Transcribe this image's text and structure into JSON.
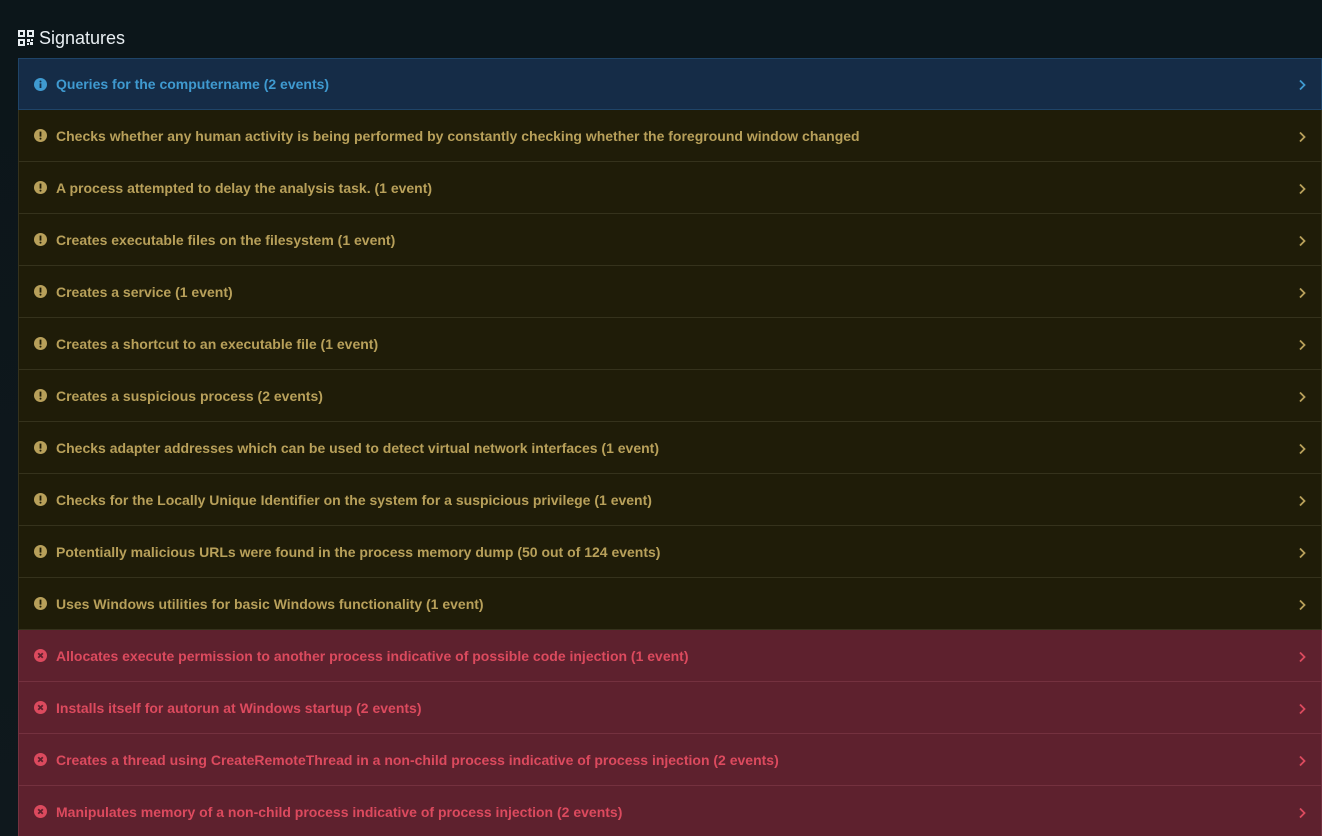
{
  "section": {
    "title": "Signatures",
    "icon": "qrcode-icon"
  },
  "colors": {
    "info_bg": "#152c47",
    "info_text": "#3f9ad0",
    "warning_bg": "#1f1c08",
    "warning_text": "#b8a05a",
    "danger_bg": "#5e212e",
    "danger_text": "#dc4a5e"
  },
  "signatures": [
    {
      "severity": "info",
      "icon": "info-circle-icon",
      "label": "Queries for the computername (2 events)"
    },
    {
      "severity": "warning",
      "icon": "exclamation-circle-icon",
      "label": "Checks whether any human activity is being performed by constantly checking whether the foreground window changed"
    },
    {
      "severity": "warning",
      "icon": "exclamation-circle-icon",
      "label": "A process attempted to delay the analysis task. (1 event)"
    },
    {
      "severity": "warning",
      "icon": "exclamation-circle-icon",
      "label": "Creates executable files on the filesystem (1 event)"
    },
    {
      "severity": "warning",
      "icon": "exclamation-circle-icon",
      "label": "Creates a service (1 event)"
    },
    {
      "severity": "warning",
      "icon": "exclamation-circle-icon",
      "label": "Creates a shortcut to an executable file (1 event)"
    },
    {
      "severity": "warning",
      "icon": "exclamation-circle-icon",
      "label": "Creates a suspicious process (2 events)"
    },
    {
      "severity": "warning",
      "icon": "exclamation-circle-icon",
      "label": "Checks adapter addresses which can be used to detect virtual network interfaces (1 event)"
    },
    {
      "severity": "warning",
      "icon": "exclamation-circle-icon",
      "label": "Checks for the Locally Unique Identifier on the system for a suspicious privilege (1 event)"
    },
    {
      "severity": "warning",
      "icon": "exclamation-circle-icon",
      "label": "Potentially malicious URLs were found in the process memory dump (50 out of 124 events)"
    },
    {
      "severity": "warning",
      "icon": "exclamation-circle-icon",
      "label": "Uses Windows utilities for basic Windows functionality (1 event)"
    },
    {
      "severity": "danger",
      "icon": "times-circle-icon",
      "label": "Allocates execute permission to another process indicative of possible code injection (1 event)"
    },
    {
      "severity": "danger",
      "icon": "times-circle-icon",
      "label": "Installs itself for autorun at Windows startup (2 events)"
    },
    {
      "severity": "danger",
      "icon": "times-circle-icon",
      "label": "Creates a thread using CreateRemoteThread in a non-child process indicative of process injection (2 events)"
    },
    {
      "severity": "danger",
      "icon": "times-circle-icon",
      "label": "Manipulates memory of a non-child process indicative of process injection (2 events)"
    }
  ]
}
